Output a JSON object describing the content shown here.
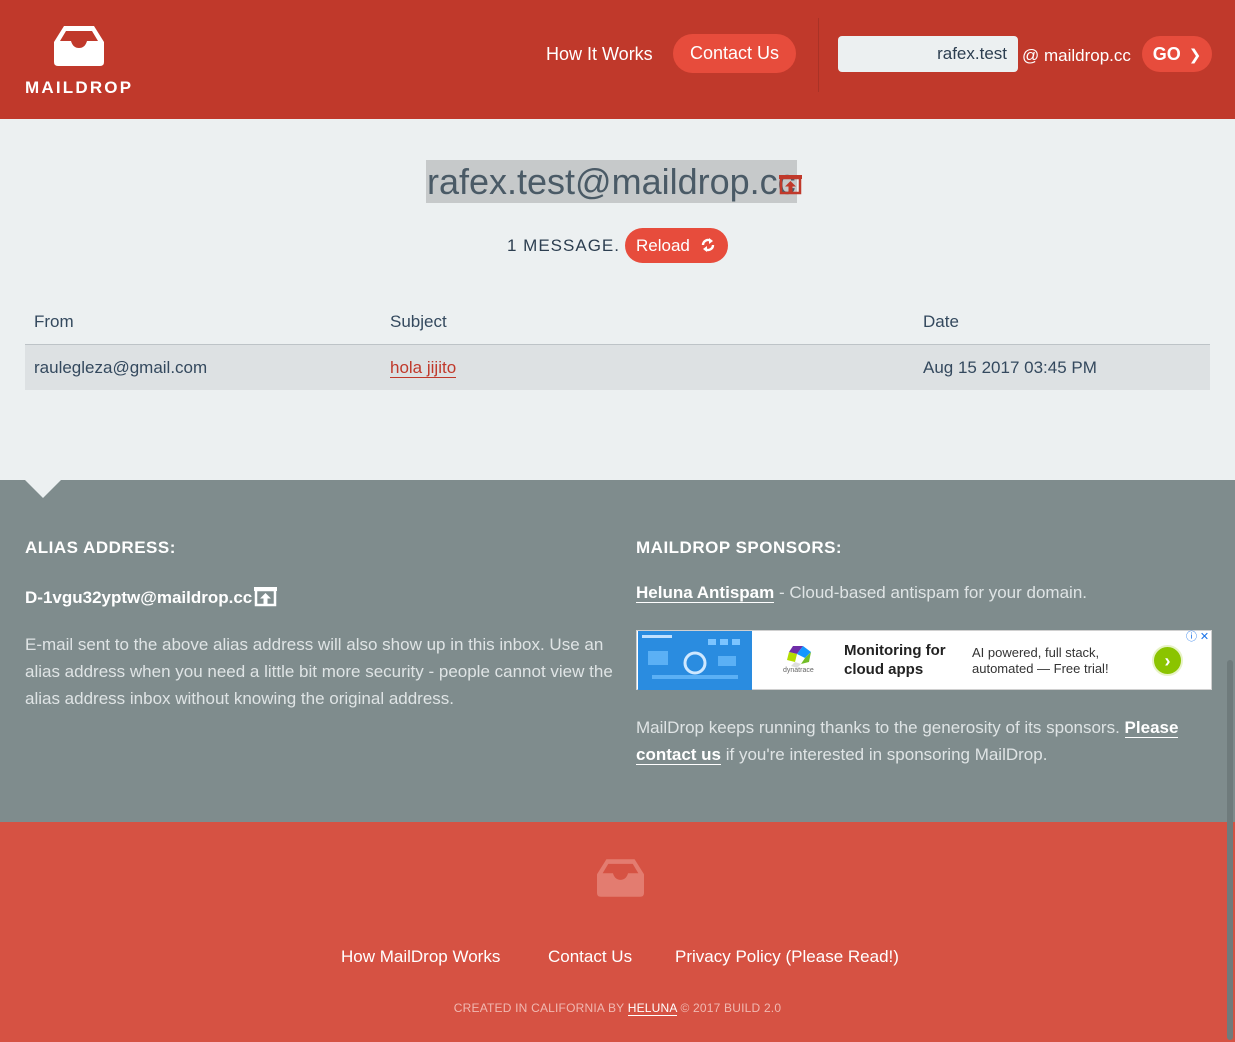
{
  "header": {
    "logo_text": "MAILDROP",
    "nav_how": "How It Works",
    "nav_contact": "Contact Us",
    "mailbox_value": "rafex.test",
    "domain_suffix": "@ maildrop.cc",
    "go_label": "GO"
  },
  "inbox": {
    "address": "rafex.test@maildrop.cc",
    "message_count": "1 MESSAGE.",
    "reload_label": "Reload",
    "columns": {
      "from": "From",
      "subject": "Subject",
      "date": "Date"
    },
    "messages": [
      {
        "from": "raulegleza@gmail.com",
        "subject": "hola jijito",
        "date": "Aug 15 2017 03:45 PM"
      }
    ]
  },
  "alias": {
    "heading": "ALIAS ADDRESS:",
    "address": "D-1vgu32yptw@maildrop.cc",
    "description": "E-mail sent to the above alias address will also show up in this inbox. Use an alias address when you need a little bit more security - people cannot view the alias address inbox without knowing the original address."
  },
  "sponsors": {
    "heading": "MAILDROP SPONSORS:",
    "sponsor_name": "Heluna Antispam",
    "sponsor_tagline": " - Cloud-based antispam for your domain.",
    "ad": {
      "brand": "dynatrace",
      "title": "Monitoring for cloud apps",
      "subtitle": "AI powered, full stack, automated — Free trial!"
    },
    "desc_start": "MailDrop keeps running thanks to the generosity of its sponsors. ",
    "desc_link": "Please contact us",
    "desc_end": " if you're interested in sponsoring MailDrop."
  },
  "footer": {
    "link_how": "How MailDrop Works",
    "link_contact": "Contact Us",
    "link_privacy": "Privacy Policy (Please Read!)",
    "credit_prefix": "CREATED IN CALIFORNIA BY ",
    "credit_brand": "HELUNA",
    "credit_suffix": " © 2017 BUILD 2.0"
  },
  "colors": {
    "header_red": "#c0392b",
    "accent_red": "#e74c3c",
    "info_gray": "#7f8c8d",
    "footer_red": "#d65243"
  }
}
